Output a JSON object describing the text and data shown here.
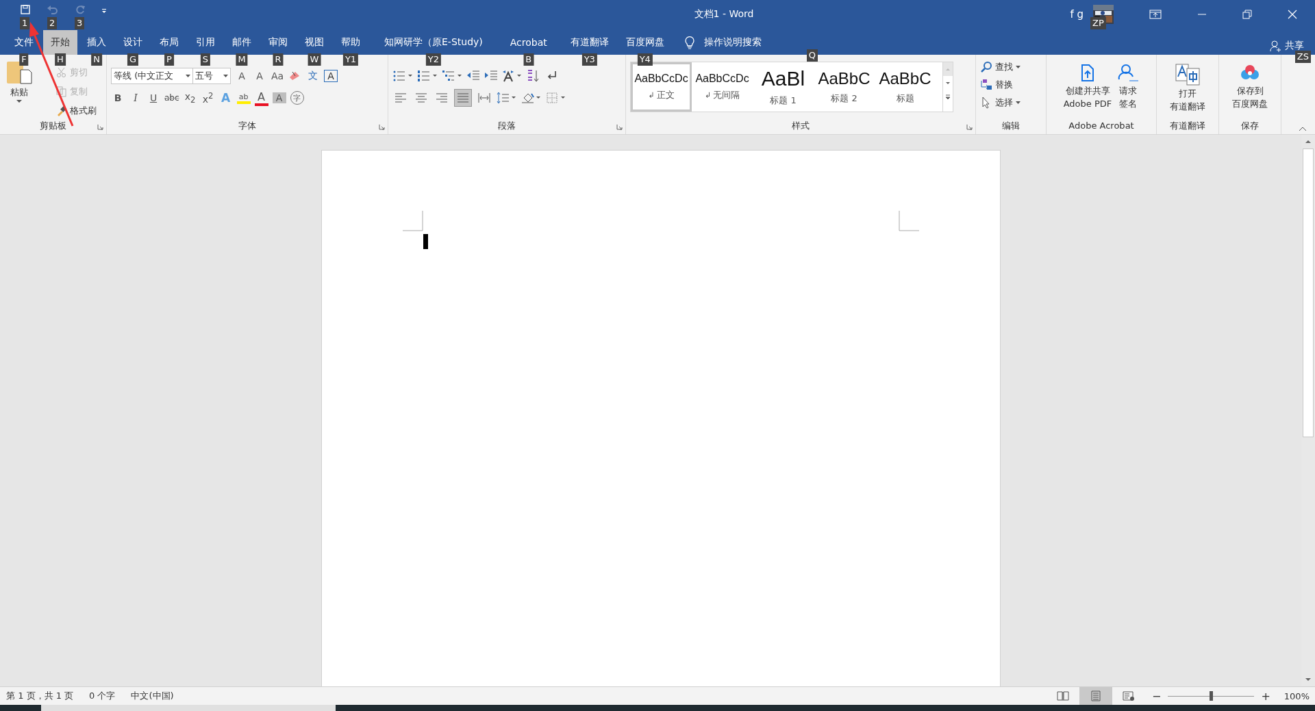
{
  "quick_access": [
    {
      "keytip": "1",
      "disabled": false
    },
    {
      "keytip": "2",
      "disabled": true
    },
    {
      "keytip": "3",
      "disabled": true
    }
  ],
  "window": {
    "title": "文档1  -  Word",
    "user": "f g",
    "avatar_keytip": "ZP"
  },
  "tabs": [
    {
      "label": "文件",
      "keytip": "F",
      "selected": false
    },
    {
      "label": "开始",
      "keytip": "H",
      "selected": true
    },
    {
      "label": "插入",
      "keytip": "N",
      "selected": false
    },
    {
      "label": "设计",
      "keytip": "G",
      "selected": false
    },
    {
      "label": "布局",
      "keytip": "P",
      "selected": false
    },
    {
      "label": "引用",
      "keytip": "S",
      "selected": false
    },
    {
      "label": "邮件",
      "keytip": "M",
      "selected": false
    },
    {
      "label": "审阅",
      "keytip": "R",
      "selected": false
    },
    {
      "label": "视图",
      "keytip": "W",
      "selected": false
    },
    {
      "label": "帮助",
      "keytip": "Y1",
      "selected": false
    },
    {
      "label": "知网研学（原E-Study)",
      "keytip": "Y2",
      "selected": false
    },
    {
      "label": "Acrobat",
      "keytip": "B",
      "selected": false
    },
    {
      "label": "有道翻译",
      "keytip": "Y3",
      "selected": false
    },
    {
      "label": "百度网盘",
      "keytip": "Y4",
      "selected": false
    }
  ],
  "tell_me": {
    "label": "操作说明搜索",
    "keytip": "Q"
  },
  "share": {
    "label": "共享",
    "keytip": "ZS"
  },
  "clipboard": {
    "paste": "粘贴",
    "items": [
      {
        "label": "剪切",
        "disabled": true
      },
      {
        "label": "复制",
        "disabled": true
      },
      {
        "label": "格式刷",
        "disabled": false
      }
    ],
    "group": "剪贴板"
  },
  "font": {
    "name": "等线 (中文正文",
    "size": "五号",
    "group": "字体",
    "row1": [
      {
        "kind": "grow",
        "glyph": "A"
      },
      {
        "kind": "shrink",
        "glyph": "A"
      },
      {
        "kind": "case",
        "glyph": "Aa"
      },
      {
        "kind": "clear"
      },
      {
        "kind": "phonetic",
        "glyph": "文"
      },
      {
        "kind": "border",
        "glyph": "A"
      }
    ],
    "row2": [
      {
        "kind": "bold",
        "glyph": "B"
      },
      {
        "kind": "italic",
        "glyph": "I"
      },
      {
        "kind": "underline",
        "glyph": "U"
      },
      {
        "kind": "strike",
        "glyph": "abc"
      },
      {
        "kind": "plain",
        "glyph": "x$_{2}$"
      },
      {
        "kind": "plain",
        "glyph": "x$^{2}$"
      },
      {
        "kind": "effect",
        "glyph": "A"
      },
      {
        "kind": "highlight",
        "glyph": "ab"
      },
      {
        "kind": "color",
        "glyph": "A"
      },
      {
        "kind": "shade",
        "glyph": "A"
      },
      {
        "kind": "enclose",
        "glyph": "字"
      }
    ]
  },
  "paragraph": {
    "group": "段落",
    "align": [
      {
        "selected": false
      },
      {
        "selected": false
      },
      {
        "selected": false
      },
      {
        "selected": true
      },
      {
        "selected": false
      }
    ]
  },
  "styles": {
    "group": "样式",
    "items": [
      {
        "preview": "AaBbCcDc",
        "mark": "↲",
        "label": "正文",
        "kind": "para",
        "selected": true
      },
      {
        "preview": "AaBbCcDc",
        "mark": "↲",
        "label": "无间隔",
        "kind": "para",
        "selected": false
      },
      {
        "preview": "AaBl",
        "label": "标题 1",
        "kind": "h1",
        "selected": false
      },
      {
        "preview": "AaBbC",
        "label": "标题 2",
        "kind": "h2",
        "selected": false
      },
      {
        "preview": "AaBbC",
        "label": "标题",
        "kind": "title",
        "selected": false
      }
    ]
  },
  "editing": {
    "group": "编辑",
    "find": "查找",
    "replace": "替换",
    "select": "选择"
  },
  "acrobat": {
    "group": "Adobe Acrobat",
    "create": [
      "创建并共享",
      "Adobe PDF"
    ],
    "sign": [
      "请求",
      "签名"
    ]
  },
  "youdao": {
    "group": "有道翻译",
    "open": [
      "打开",
      "有道翻译"
    ]
  },
  "baidu": {
    "group": "保存",
    "save": [
      "保存到",
      "百度网盘"
    ]
  },
  "status_bar": {
    "pages": "第 1 页，共 1 页",
    "words": "0 个字",
    "language": "中文(中国)",
    "views": [
      {
        "selected": false
      },
      {
        "selected": true
      },
      {
        "selected": false
      }
    ],
    "zoom_out": "−",
    "zoom_slider": {
      "level": 0.5
    },
    "zoom_in": "+",
    "zoom": "100%"
  }
}
